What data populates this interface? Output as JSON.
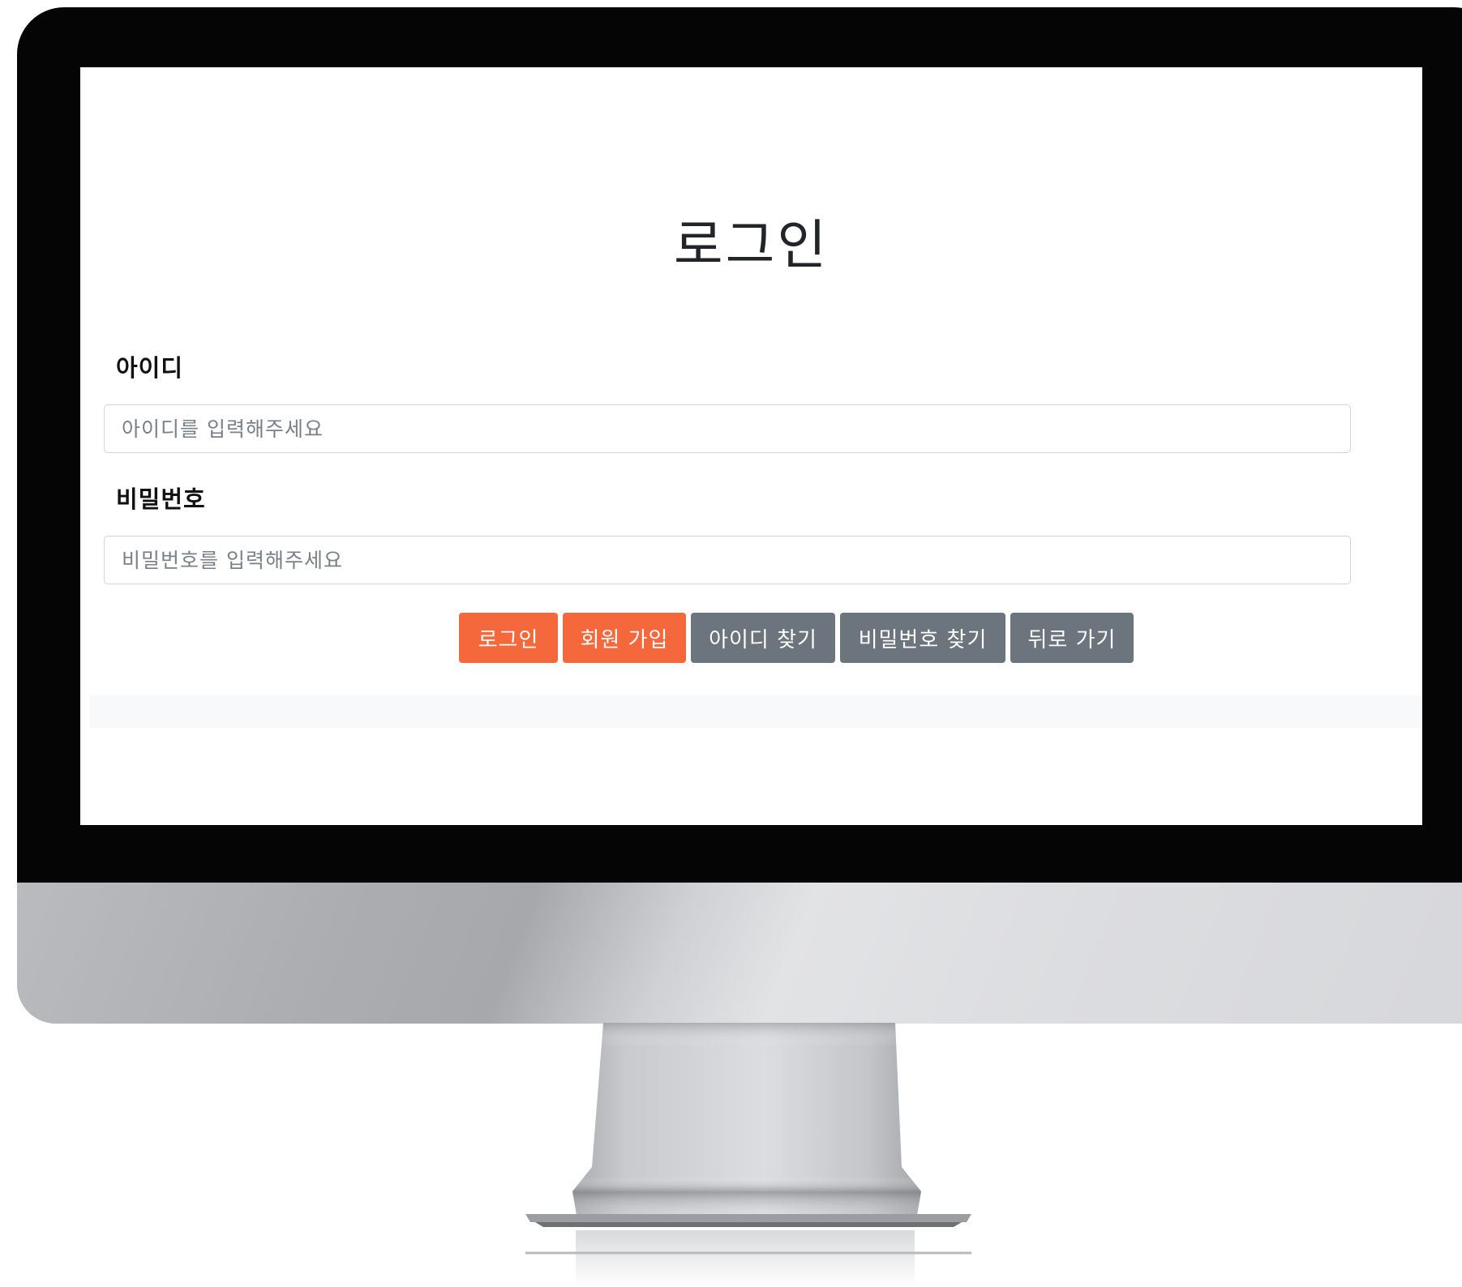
{
  "page": {
    "title": "로그인"
  },
  "form": {
    "id_label": "아이디",
    "id_placeholder": "아이디를 입력해주세요",
    "password_label": "비밀번호",
    "password_placeholder": "비밀번호를 입력해주세요"
  },
  "buttons": {
    "login": "로그인",
    "signup": "회원 가입",
    "find_id": "아이디 찾기",
    "find_password": "비밀번호 찾기",
    "back": "뒤로 가기"
  },
  "colors": {
    "primary_button": "#f4683b",
    "secondary_button": "#6c757d",
    "monitor_bezel": "#050505"
  }
}
